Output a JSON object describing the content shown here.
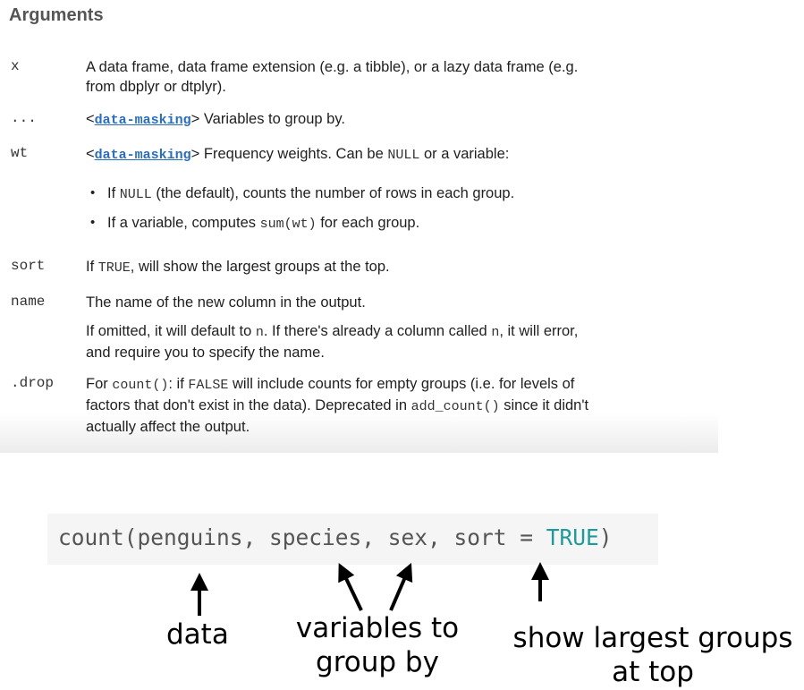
{
  "heading": "Arguments",
  "args": [
    {
      "name": "x",
      "desc_line1": "A data frame, data frame extension (e.g. a tibble), or a lazy data frame (e.g.",
      "desc_line2": "from dbplyr or dtplyr)."
    },
    {
      "name": "...",
      "lt": "<",
      "link": "data-masking",
      "gt": ">",
      "desc": " Variables to group by."
    },
    {
      "name": "wt",
      "lt": "<",
      "link": "data-masking",
      "gt": ">",
      "desc_a": " Frequency weights. Can be ",
      "code_null": "NULL",
      "desc_b": " or a variable:",
      "bullet1_a": "If ",
      "bullet1_code": "NULL",
      "bullet1_b": " (the default), counts the number of rows in each group.",
      "bullet2_a": "If a variable, computes ",
      "bullet2_code": "sum(wt)",
      "bullet2_b": " for each group."
    },
    {
      "name": "sort",
      "desc_a": "If ",
      "code_true": "TRUE",
      "desc_b": ", will show the largest groups at the top."
    },
    {
      "name": "name",
      "desc": "The name of the new column in the output.",
      "p2_a": "If omitted, it will default to ",
      "p2_code1": "n",
      "p2_b": ". If there's already a column called ",
      "p2_code2": "n",
      "p2_c": ", it will error,",
      "p2_line2": "and require you to specify the name."
    },
    {
      "name": ".drop",
      "l1_a": "For ",
      "l1_code": "count()",
      "l1_b": ": if ",
      "l1_code2": "FALSE",
      "l1_c": " will include counts for empty groups (i.e. for levels of",
      "l2_a": "factors that don't exist in the data). Deprecated in ",
      "l2_code": "add_count()",
      "l2_b": " since it didn't",
      "l3": "actually affect the output."
    }
  ],
  "code_example": {
    "prefix": "count(penguins, species, sex, sort = ",
    "keyword": "TRUE",
    "suffix": ")"
  },
  "annotations": {
    "data": "data",
    "vars_line1": "variables to",
    "vars_line2": "group by",
    "sort_line1": "show largest groups",
    "sort_line2": "at top"
  },
  "colors": {
    "link": "#2a6ebb",
    "keyword": "#1f9a9a",
    "code_bg": "#f5f5f5",
    "heading": "#555555"
  }
}
